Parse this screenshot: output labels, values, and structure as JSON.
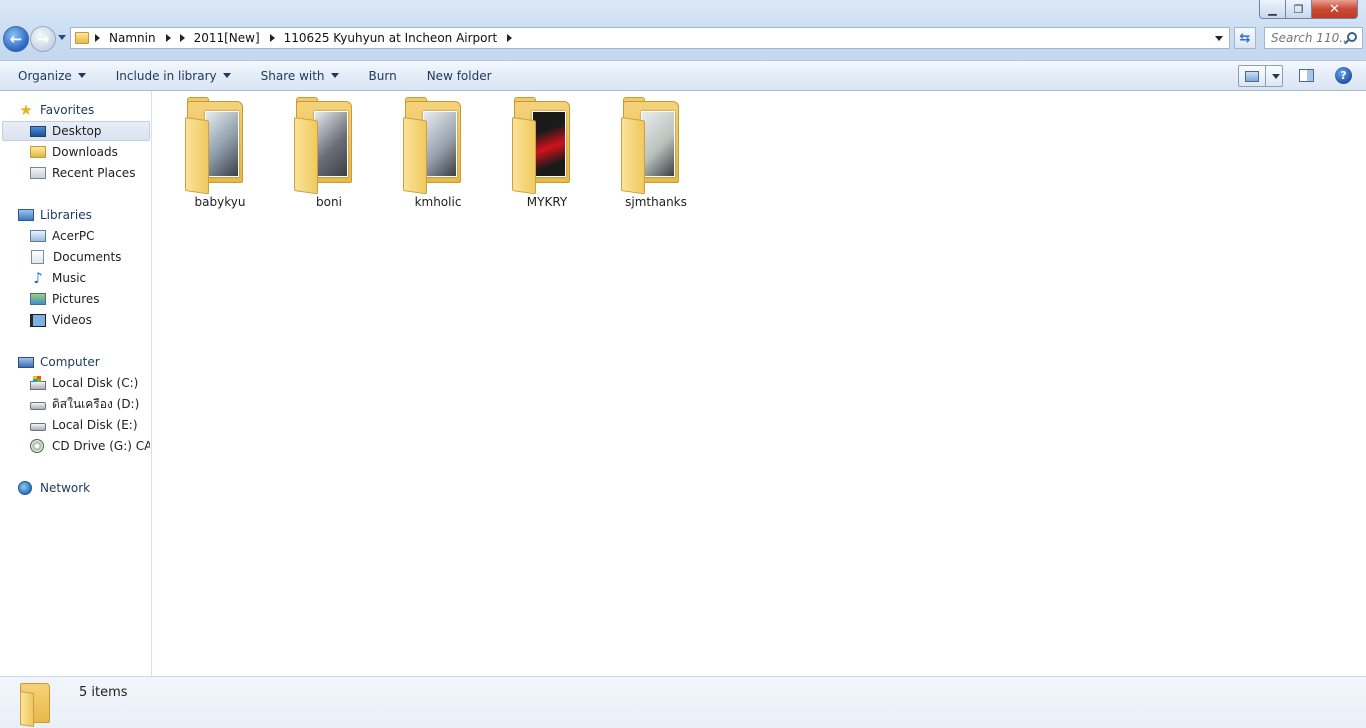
{
  "window": {
    "controls": {
      "minimize": "▁",
      "maximize": "❐",
      "close": "✕"
    }
  },
  "address": {
    "crumbs": [
      "Namnin",
      "2011[New]",
      "110625 Kyuhyun at Incheon Airport"
    ],
    "search_placeholder": "Search 110..."
  },
  "toolbar": {
    "organize": "Organize",
    "include_in_library": "Include in library",
    "share_with": "Share with",
    "burn": "Burn",
    "new_folder": "New folder",
    "help": "?"
  },
  "nav": {
    "favorites": {
      "label": "Favorites",
      "items": [
        "Desktop",
        "Downloads",
        "Recent Places"
      ]
    },
    "libraries": {
      "label": "Libraries",
      "items": [
        "AcerPC",
        "Documents",
        "Music",
        "Pictures",
        "Videos"
      ]
    },
    "computer": {
      "label": "Computer",
      "items": [
        "Local Disk (C:)",
        "ดิสในเครือง (D:)",
        "Local Disk (E:)",
        "CD Drive (G:) CAT (("
      ]
    },
    "network": {
      "label": "Network"
    }
  },
  "folders": [
    {
      "name": "babykyu",
      "photo": "#8a9aa6"
    },
    {
      "name": "boni",
      "photo": "#6b6f78"
    },
    {
      "name": "kmholic",
      "photo": "#9aa4b0"
    },
    {
      "name": "MYKRY",
      "photo": "#1a1a1a"
    },
    {
      "name": "sjmthanks",
      "photo": "#b9c2bd"
    }
  ],
  "status": {
    "item_count": "5 items"
  },
  "colors": {
    "accent": "#1e395b",
    "folder": "#e8b94a",
    "mykry_red": "#d0121b"
  }
}
